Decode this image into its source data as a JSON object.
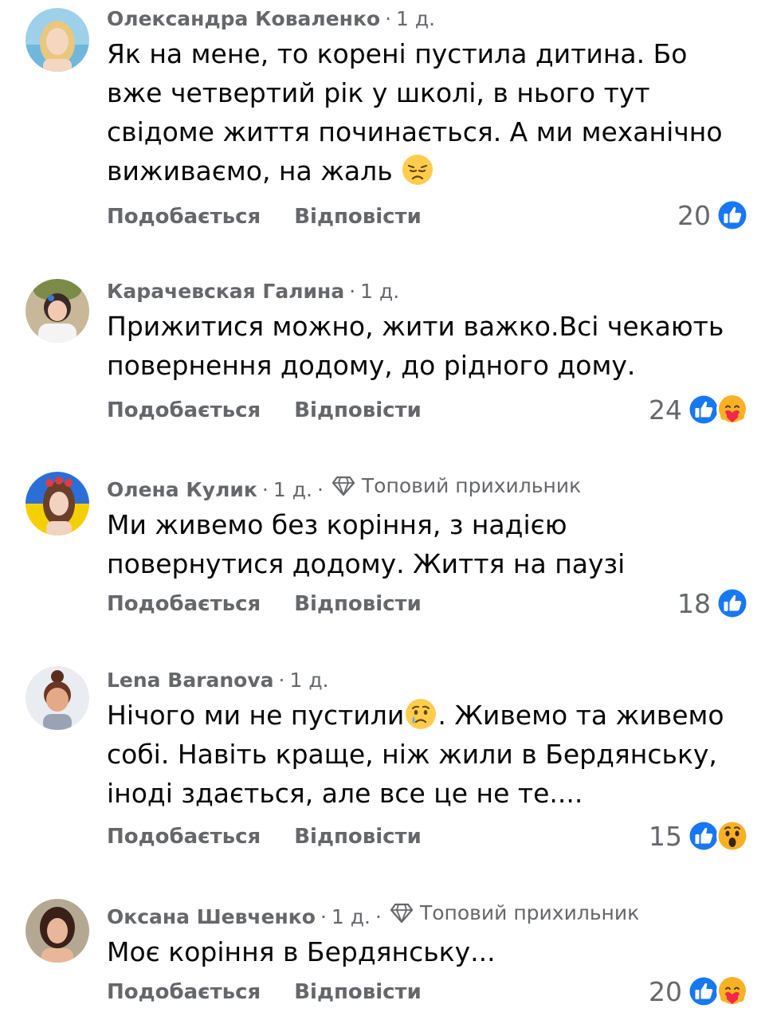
{
  "comments": [
    {
      "author": "Олександра Коваленко",
      "time": "1 д.",
      "badge": "",
      "text": "Як на мене, то корені пустила дитина. Бо вже четвертий рік у школі, в нього тут свідоме життя починається. А ми механічно виживаємо, на жаль",
      "text_emoji": "disappointed-face-emoji",
      "like_label": "Подобається",
      "reply_label": "Відповісти",
      "reaction_count": "20",
      "reactions": [
        "like-reaction-icon"
      ]
    },
    {
      "author": "Карачевская Галина",
      "time": "1 д.",
      "badge": "",
      "text": "Прижитися можно, жити важко.Всі чекають повернення додому, до рідного дому.",
      "like_label": "Подобається",
      "reply_label": "Відповісти",
      "reaction_count": "24",
      "reactions": [
        "like-reaction-icon",
        "care-reaction-icon"
      ]
    },
    {
      "author": "Олена Кулик",
      "time": "1 д.",
      "badge": "Топовий прихильник",
      "text": "Ми живемо без коріння, з надією повернутися додому. Життя на паузі",
      "like_label": "Подобається",
      "reply_label": "Відповісти",
      "reaction_count": "18",
      "reactions": [
        "like-reaction-icon"
      ]
    },
    {
      "author": "Lena Baranova",
      "time": "1 д.",
      "badge": "",
      "text_before": "Нічого ми не пустили",
      "text_after": ". Живемо та живемо собі. Навіть краще, ніж жили в Бердянську, іноді здається, але все це не те....",
      "text_emoji": "crying-face-emoji",
      "like_label": "Подобається",
      "reply_label": "Відповісти",
      "reaction_count": "15",
      "reactions": [
        "like-reaction-icon",
        "wow-reaction-icon"
      ]
    },
    {
      "author": "Оксана Шевченко",
      "time": "1 д.",
      "badge": "Топовий прихильник",
      "text": "Моє коріння в Бердянську...",
      "like_label": "Подобається",
      "reply_label": "Відповісти",
      "reaction_count": "20",
      "reactions": [
        "like-reaction-icon",
        "care-reaction-icon"
      ]
    }
  ],
  "colors": {
    "secondary_text": "#65676b",
    "primary_text": "#050505",
    "like_blue": "#1877f2",
    "reaction_yellow": "#f7b125"
  }
}
